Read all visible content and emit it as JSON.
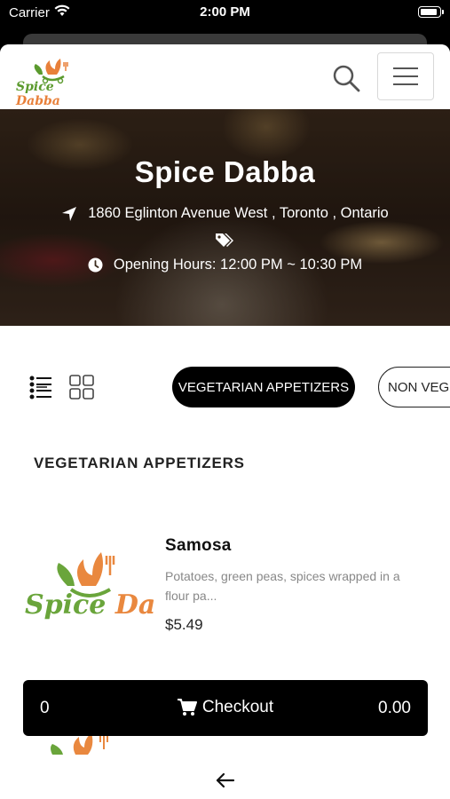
{
  "status_bar": {
    "carrier": "Carrier",
    "time": "2:00 PM"
  },
  "header": {
    "logo_text_part1": "Spice ",
    "logo_text_part2": "Dabba"
  },
  "hero": {
    "title": "Spice Dabba",
    "address": "1860 Eglinton Avenue West , Toronto , Ontario",
    "hours": "Opening Hours: 12:00 PM ~ 10:30 PM"
  },
  "categories": [
    {
      "label": "VEGETARIAN APPETIZERS",
      "active": true
    },
    {
      "label": "NON VEG",
      "active": false
    }
  ],
  "section_title": "VEGETARIAN APPETIZERS",
  "items": [
    {
      "name": "Samosa",
      "description": "Potatoes, green peas, spices wrapped in a flour pa...",
      "price": "$5.49",
      "image_text_part1": "Spice ",
      "image_text_part2": "Dabba"
    }
  ],
  "checkout": {
    "count": "0",
    "label": "Checkout",
    "total": "0.00"
  },
  "colors": {
    "brand_green": "#5b9a2e",
    "brand_orange": "#e8803a",
    "primary": "#000000"
  }
}
